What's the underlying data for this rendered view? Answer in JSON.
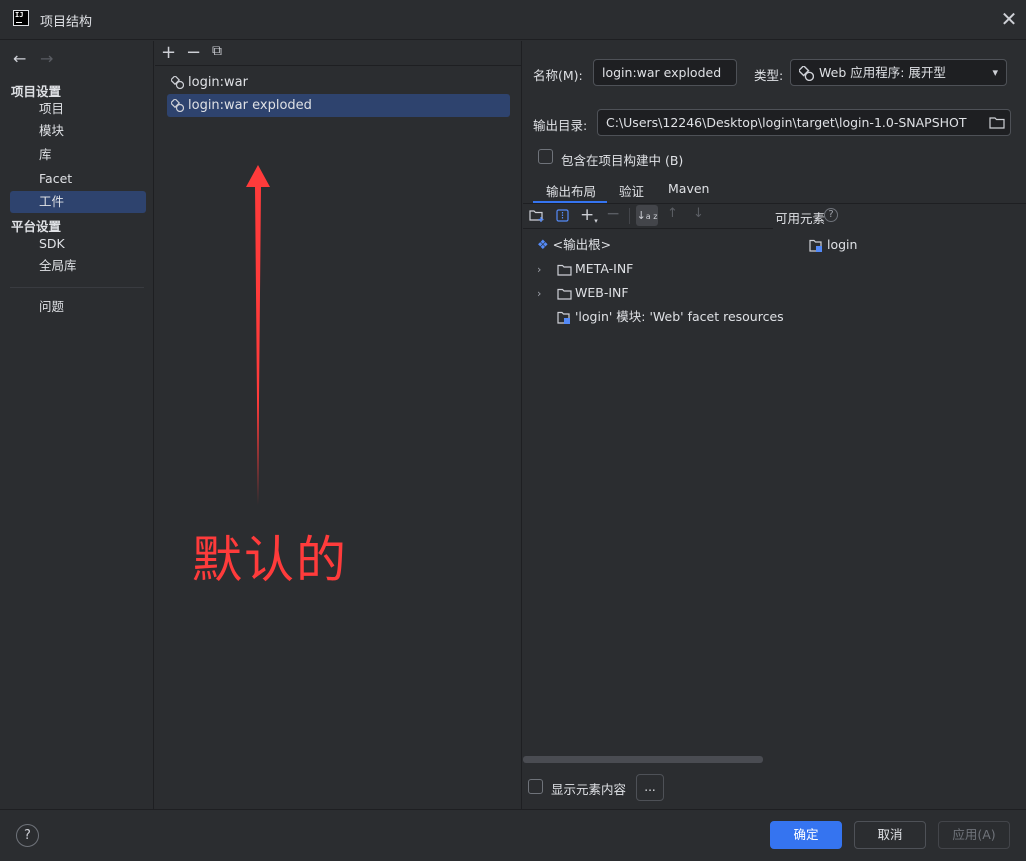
{
  "window": {
    "title": "项目结构",
    "close": "✕"
  },
  "sidebar": {
    "back": "←",
    "forward": "→",
    "section_project": "项目设置",
    "items_project": [
      "项目",
      "模块",
      "库",
      "Facet",
      "工件"
    ],
    "section_platform": "平台设置",
    "items_platform": [
      "SDK",
      "全局库"
    ],
    "problems": "问题",
    "selected": "工件"
  },
  "middle": {
    "toolbar": {
      "add": "+",
      "remove": "−",
      "copy": "⧉"
    },
    "artifacts": [
      "login:war",
      "login:war exploded"
    ],
    "selected": "login:war exploded",
    "annotation": "默认的"
  },
  "details": {
    "name_label": "名称(M):",
    "name_value": "login:war exploded",
    "type_label": "类型:",
    "type_value": "Web 应用程序: 展开型",
    "output_label": "输出目录:",
    "output_value": "C:\\Users\\12246\\Desktop\\login\\target\\login-1.0-SNAPSHOT",
    "include_in_build": "包含在项目构建中 (B)",
    "tabs": [
      "输出布局",
      "验证",
      "Maven"
    ],
    "active_tab": "输出布局",
    "available_elements_label": "可用元素",
    "available_elements": [
      "login"
    ],
    "tree": {
      "root": "<输出根>",
      "children": [
        "META-INF",
        "WEB-INF"
      ],
      "resource": "'login' 模块: 'Web' facet resources"
    },
    "show_content": "显示元素内容",
    "more": "..."
  },
  "footer": {
    "help": "?",
    "ok": "确定",
    "cancel": "取消",
    "apply": "应用(A)"
  },
  "colors": {
    "accent": "#3574f0",
    "selection": "#2e436e",
    "annotation": "#ff3b3b"
  }
}
